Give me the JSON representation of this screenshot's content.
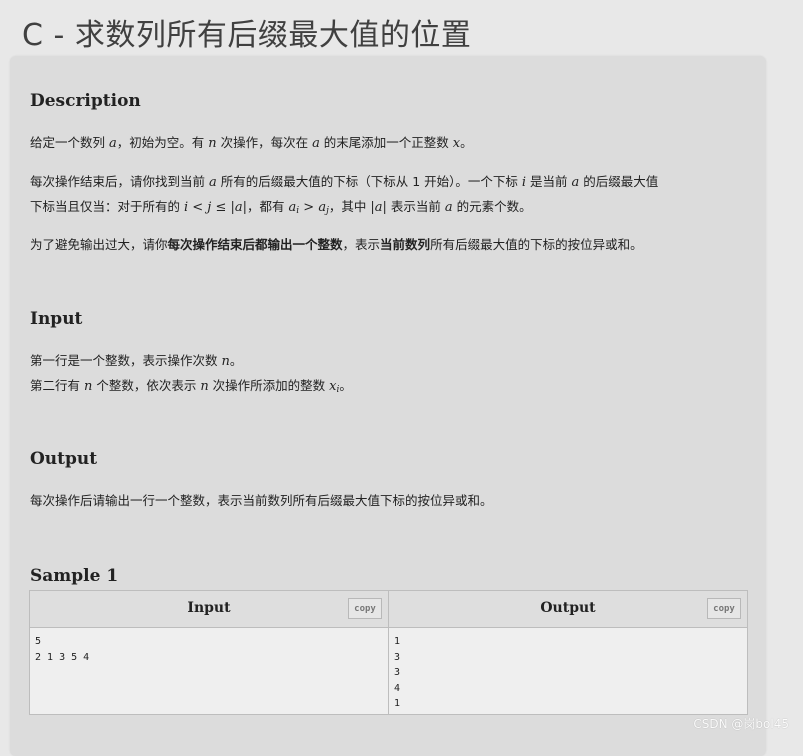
{
  "title": "C - 求数列所有后缀最大值的位置",
  "description": {
    "heading": "Description",
    "p1": [
      "给定一个数列 ",
      "a",
      "，初始为空。有 ",
      "n",
      " 次操作，每次在 ",
      "a",
      " 的末尾添加一个正整数 ",
      "x",
      "。"
    ],
    "p2_line1": [
      "每次操作结束后，请你找到当前 ",
      "a",
      " 所有的后缀最大值的下标（下标从 1 开始）。一个下标 ",
      "i",
      " 是当前 ",
      "a",
      " 的后缀最大值"
    ],
    "p2_line2": [
      "下标当且仅当：对于所有的 ",
      "i < j ≤ |a|",
      "，都有 ",
      "a",
      "i",
      " > ",
      "a",
      "j",
      "，其中 ",
      "|a|",
      " 表示当前 ",
      "a",
      " 的元素个数。"
    ],
    "p3": [
      "为了避免输出过大，请你",
      "每次操作结束后都输出一个整数",
      "，表示",
      "当前数列",
      "所有后缀最大值的下标的按位异或和。"
    ]
  },
  "input": {
    "heading": "Input",
    "line1": [
      "第一行是一个整数，表示操作次数 ",
      "n",
      "。"
    ],
    "line2": [
      "第二行有 ",
      "n",
      " 个整数，依次表示 ",
      "n",
      " 次操作所添加的整数 ",
      "x",
      "i",
      "。"
    ]
  },
  "output": {
    "heading": "Output",
    "line1": "每次操作后请输出一行一个整数，表示当前数列所有后缀最大值下标的按位异或和。"
  },
  "sample": {
    "heading": "Sample 1",
    "input_label": "Input",
    "output_label": "Output",
    "copy_label": "copy",
    "input_text": "5\n2 1 3 5 4",
    "output_text": "1\n3\n3\n4\n1"
  },
  "watermark": "CSDN @岗bol45"
}
